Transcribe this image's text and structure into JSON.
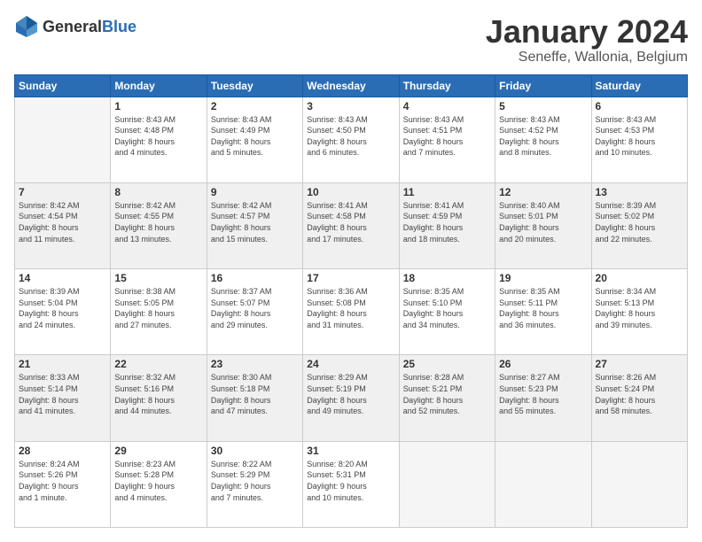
{
  "logo": {
    "general": "General",
    "blue": "Blue"
  },
  "header": {
    "month": "January 2024",
    "location": "Seneffe, Wallonia, Belgium"
  },
  "weekdays": [
    "Sunday",
    "Monday",
    "Tuesday",
    "Wednesday",
    "Thursday",
    "Friday",
    "Saturday"
  ],
  "weeks": [
    [
      {
        "day": "",
        "info": ""
      },
      {
        "day": "1",
        "info": "Sunrise: 8:43 AM\nSunset: 4:48 PM\nDaylight: 8 hours\nand 4 minutes."
      },
      {
        "day": "2",
        "info": "Sunrise: 8:43 AM\nSunset: 4:49 PM\nDaylight: 8 hours\nand 5 minutes."
      },
      {
        "day": "3",
        "info": "Sunrise: 8:43 AM\nSunset: 4:50 PM\nDaylight: 8 hours\nand 6 minutes."
      },
      {
        "day": "4",
        "info": "Sunrise: 8:43 AM\nSunset: 4:51 PM\nDaylight: 8 hours\nand 7 minutes."
      },
      {
        "day": "5",
        "info": "Sunrise: 8:43 AM\nSunset: 4:52 PM\nDaylight: 8 hours\nand 8 minutes."
      },
      {
        "day": "6",
        "info": "Sunrise: 8:43 AM\nSunset: 4:53 PM\nDaylight: 8 hours\nand 10 minutes."
      }
    ],
    [
      {
        "day": "7",
        "info": "Sunrise: 8:42 AM\nSunset: 4:54 PM\nDaylight: 8 hours\nand 11 minutes."
      },
      {
        "day": "8",
        "info": "Sunrise: 8:42 AM\nSunset: 4:55 PM\nDaylight: 8 hours\nand 13 minutes."
      },
      {
        "day": "9",
        "info": "Sunrise: 8:42 AM\nSunset: 4:57 PM\nDaylight: 8 hours\nand 15 minutes."
      },
      {
        "day": "10",
        "info": "Sunrise: 8:41 AM\nSunset: 4:58 PM\nDaylight: 8 hours\nand 17 minutes."
      },
      {
        "day": "11",
        "info": "Sunrise: 8:41 AM\nSunset: 4:59 PM\nDaylight: 8 hours\nand 18 minutes."
      },
      {
        "day": "12",
        "info": "Sunrise: 8:40 AM\nSunset: 5:01 PM\nDaylight: 8 hours\nand 20 minutes."
      },
      {
        "day": "13",
        "info": "Sunrise: 8:39 AM\nSunset: 5:02 PM\nDaylight: 8 hours\nand 22 minutes."
      }
    ],
    [
      {
        "day": "14",
        "info": "Sunrise: 8:39 AM\nSunset: 5:04 PM\nDaylight: 8 hours\nand 24 minutes."
      },
      {
        "day": "15",
        "info": "Sunrise: 8:38 AM\nSunset: 5:05 PM\nDaylight: 8 hours\nand 27 minutes."
      },
      {
        "day": "16",
        "info": "Sunrise: 8:37 AM\nSunset: 5:07 PM\nDaylight: 8 hours\nand 29 minutes."
      },
      {
        "day": "17",
        "info": "Sunrise: 8:36 AM\nSunset: 5:08 PM\nDaylight: 8 hours\nand 31 minutes."
      },
      {
        "day": "18",
        "info": "Sunrise: 8:35 AM\nSunset: 5:10 PM\nDaylight: 8 hours\nand 34 minutes."
      },
      {
        "day": "19",
        "info": "Sunrise: 8:35 AM\nSunset: 5:11 PM\nDaylight: 8 hours\nand 36 minutes."
      },
      {
        "day": "20",
        "info": "Sunrise: 8:34 AM\nSunset: 5:13 PM\nDaylight: 8 hours\nand 39 minutes."
      }
    ],
    [
      {
        "day": "21",
        "info": "Sunrise: 8:33 AM\nSunset: 5:14 PM\nDaylight: 8 hours\nand 41 minutes."
      },
      {
        "day": "22",
        "info": "Sunrise: 8:32 AM\nSunset: 5:16 PM\nDaylight: 8 hours\nand 44 minutes."
      },
      {
        "day": "23",
        "info": "Sunrise: 8:30 AM\nSunset: 5:18 PM\nDaylight: 8 hours\nand 47 minutes."
      },
      {
        "day": "24",
        "info": "Sunrise: 8:29 AM\nSunset: 5:19 PM\nDaylight: 8 hours\nand 49 minutes."
      },
      {
        "day": "25",
        "info": "Sunrise: 8:28 AM\nSunset: 5:21 PM\nDaylight: 8 hours\nand 52 minutes."
      },
      {
        "day": "26",
        "info": "Sunrise: 8:27 AM\nSunset: 5:23 PM\nDaylight: 8 hours\nand 55 minutes."
      },
      {
        "day": "27",
        "info": "Sunrise: 8:26 AM\nSunset: 5:24 PM\nDaylight: 8 hours\nand 58 minutes."
      }
    ],
    [
      {
        "day": "28",
        "info": "Sunrise: 8:24 AM\nSunset: 5:26 PM\nDaylight: 9 hours\nand 1 minute."
      },
      {
        "day": "29",
        "info": "Sunrise: 8:23 AM\nSunset: 5:28 PM\nDaylight: 9 hours\nand 4 minutes."
      },
      {
        "day": "30",
        "info": "Sunrise: 8:22 AM\nSunset: 5:29 PM\nDaylight: 9 hours\nand 7 minutes."
      },
      {
        "day": "31",
        "info": "Sunrise: 8:20 AM\nSunset: 5:31 PM\nDaylight: 9 hours\nand 10 minutes."
      },
      {
        "day": "",
        "info": ""
      },
      {
        "day": "",
        "info": ""
      },
      {
        "day": "",
        "info": ""
      }
    ]
  ]
}
